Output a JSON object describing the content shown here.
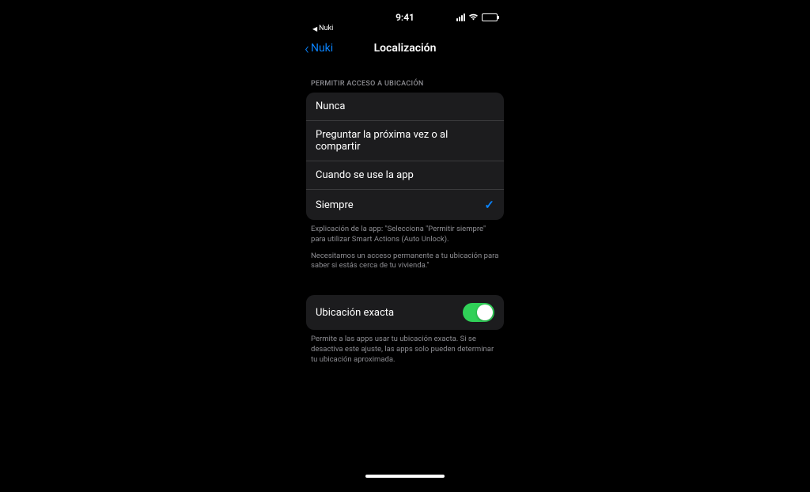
{
  "statusBar": {
    "time": "9:41",
    "breadcrumbApp": "Nuki"
  },
  "nav": {
    "back": "Nuki",
    "title": "Localización"
  },
  "locationAccess": {
    "header": "PERMITIR ACCESO A UBICACIÓN",
    "options": [
      {
        "label": "Nunca",
        "selected": false
      },
      {
        "label": "Preguntar la próxima vez o al compartir",
        "selected": false
      },
      {
        "label": "Cuando se use la app",
        "selected": false
      },
      {
        "label": "Siempre",
        "selected": true
      }
    ],
    "footer1": "Explicación de la app: \"Selecciona \"Permitir siempre\" para utilizar Smart Actions (Auto Unlock).",
    "footer2": "Necesitamos un acceso permanente a tu ubicación para saber si estás cerca de tu vivienda.\""
  },
  "preciseLocation": {
    "label": "Ubicación exacta",
    "enabled": true,
    "footer": "Permite a las apps usar tu ubicación exacta. Si se desactiva este ajuste, las apps solo pueden determinar tu ubicación aproximada."
  }
}
